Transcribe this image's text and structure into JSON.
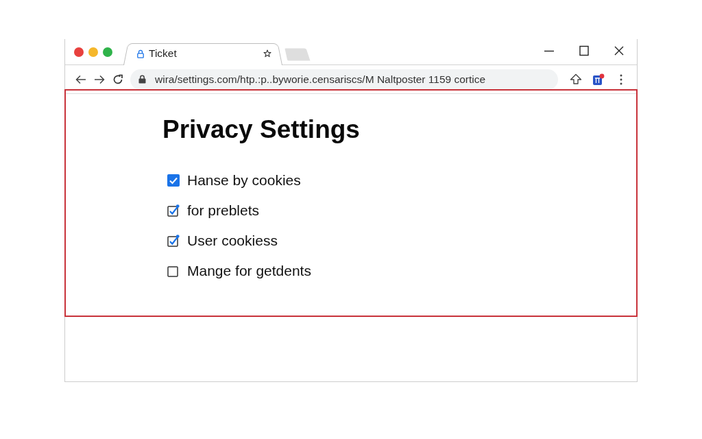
{
  "tabs": [
    {
      "title": "Ticket",
      "selected": true
    }
  ],
  "address_bar": {
    "url": "wira/settings.com/htp.:p..byworie.censariscs/M Naltposter 1159 cortice"
  },
  "page": {
    "title": "Privacy Settings",
    "highlighted": true,
    "options": [
      {
        "label": "Hanse by cookies",
        "checked": true,
        "kind": "filled"
      },
      {
        "label": "for preblets",
        "checked": true,
        "kind": "outline"
      },
      {
        "label": "User cookiess",
        "checked": true,
        "kind": "outline"
      },
      {
        "label": "Mange for getdents",
        "checked": false,
        "kind": "outline"
      }
    ]
  }
}
